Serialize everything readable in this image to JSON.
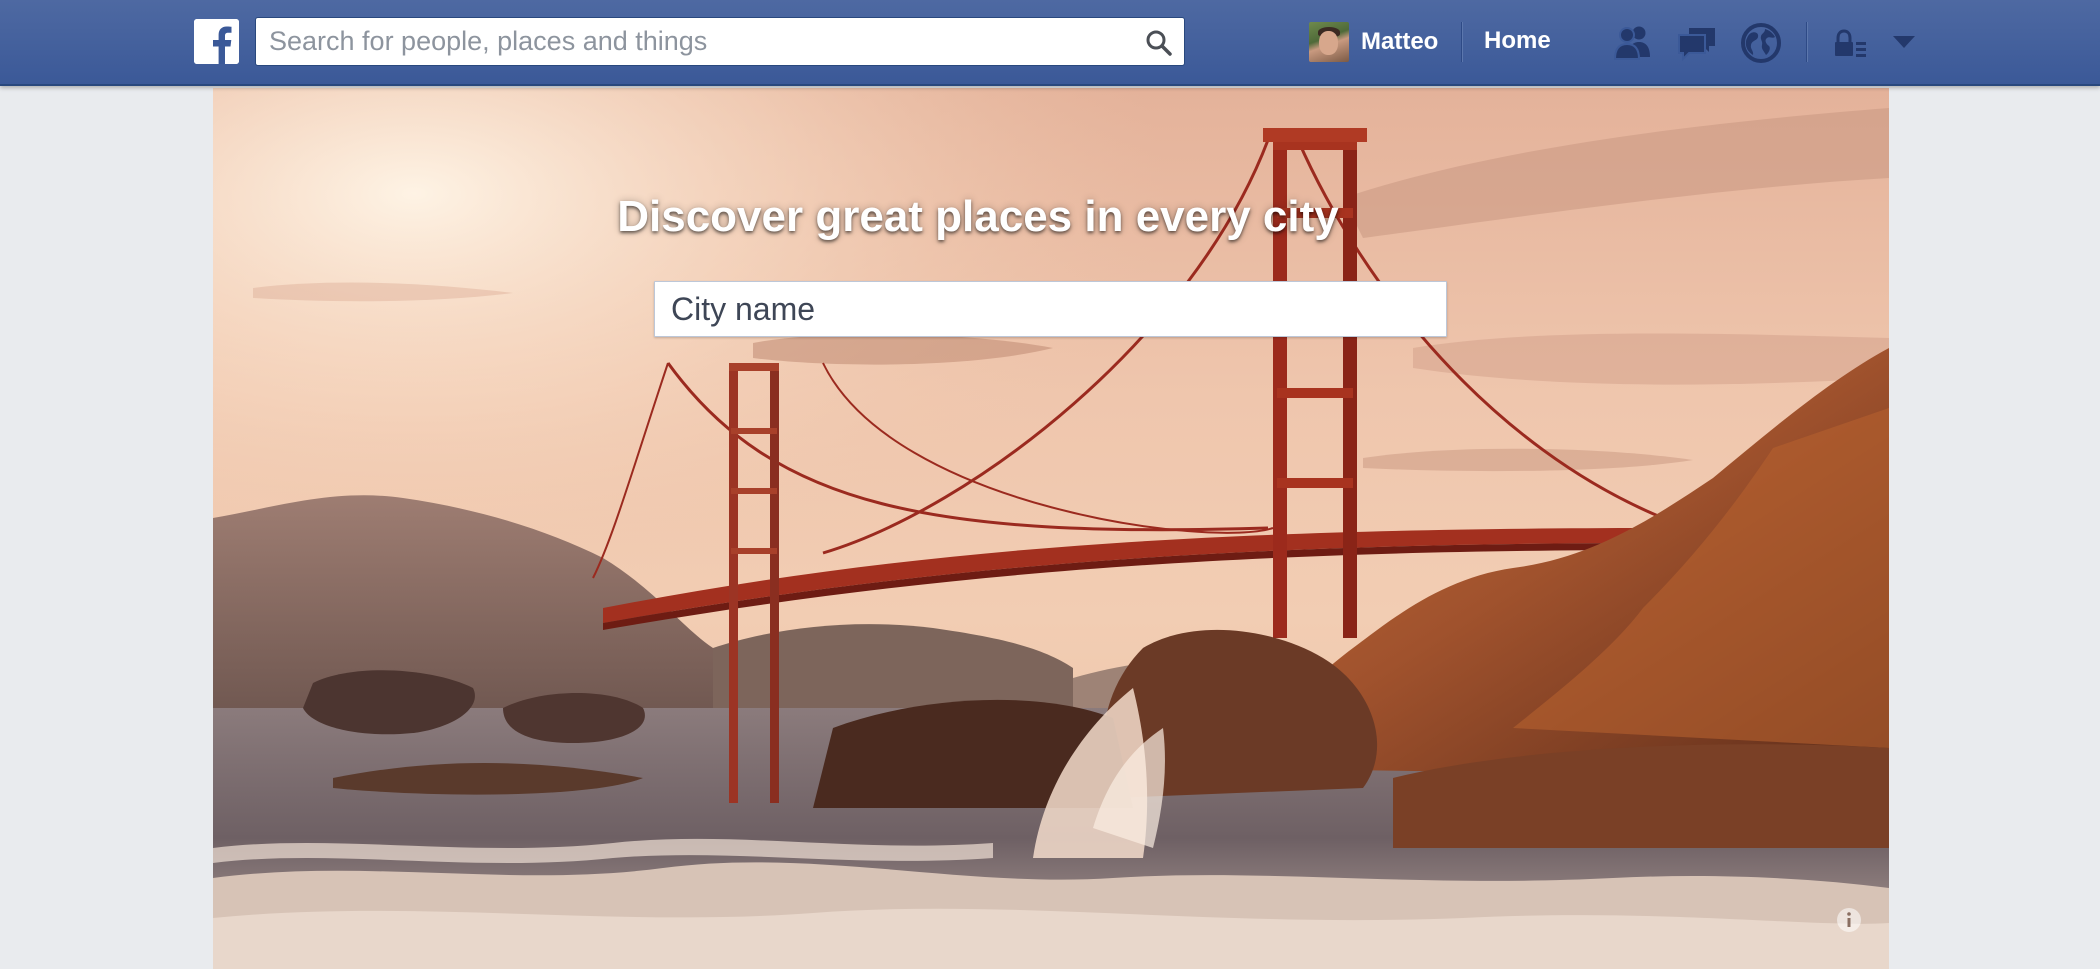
{
  "header": {
    "search_placeholder": "Search for people, places and things",
    "user_name": "Matteo",
    "home_label": "Home",
    "icons": [
      "facebook-logo",
      "search-icon",
      "friend-requests-icon",
      "messages-icon",
      "notifications-globe-icon",
      "privacy-shortcuts-icon",
      "chevron-down-icon"
    ]
  },
  "hero": {
    "title": "Discover great places in every city",
    "city_placeholder": "City name",
    "info_icon": "info-icon"
  },
  "colors": {
    "topbar": "#3b5998",
    "page_background": "#e9ebee"
  }
}
